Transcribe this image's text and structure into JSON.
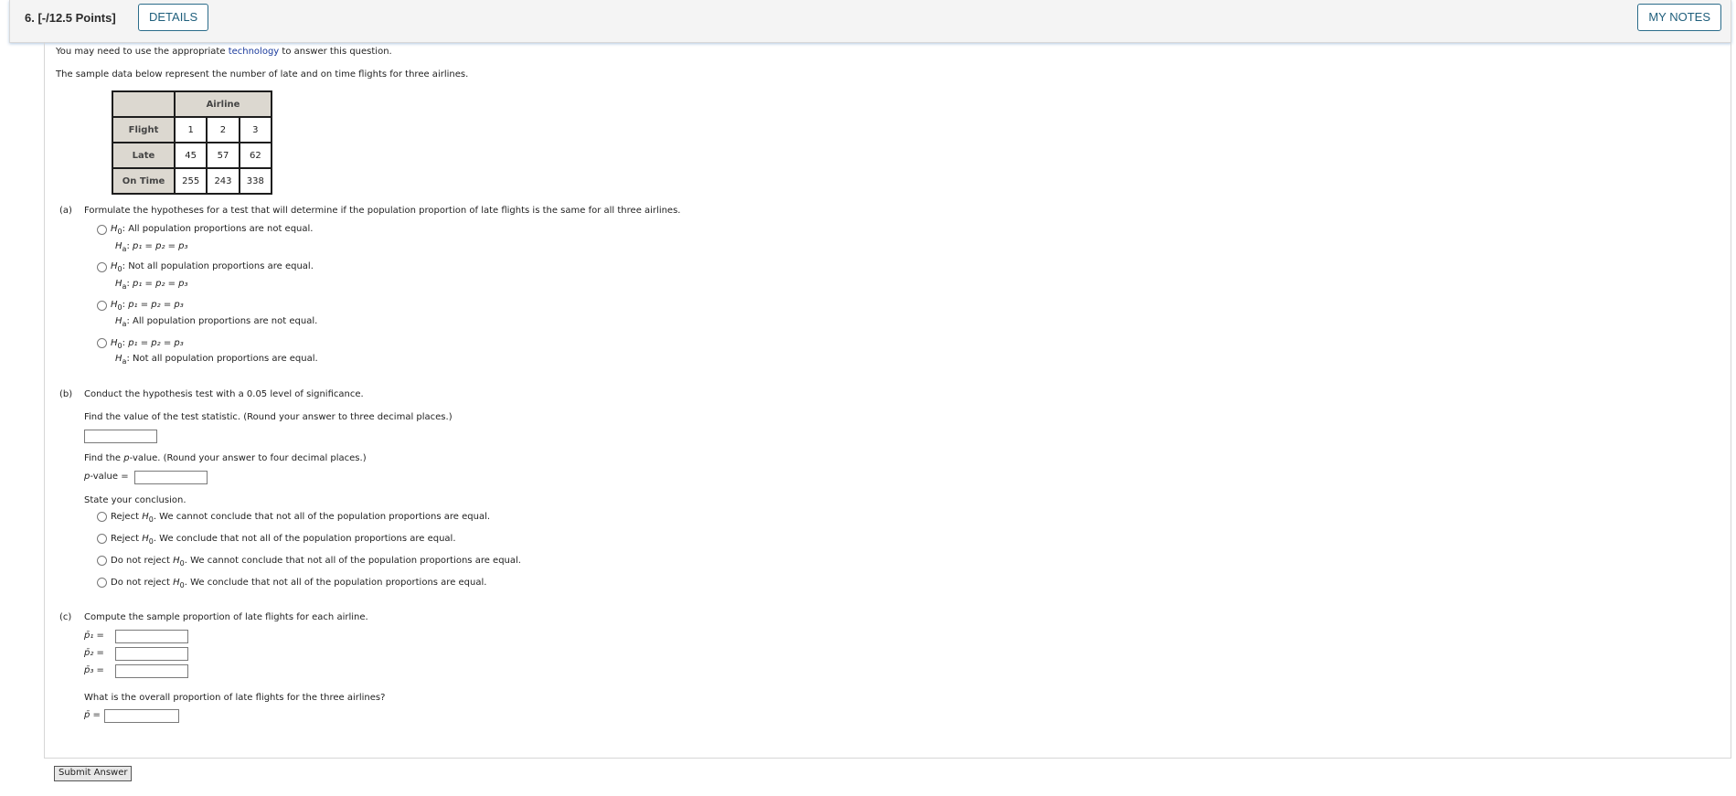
{
  "header": {
    "question_number": "6.  [-/12.5 Points]",
    "details_label": "DETAILS",
    "notes_label": "MY NOTES"
  },
  "intro": {
    "tech_prefix": "You may need to use the appropriate ",
    "tech_link": "technology",
    "tech_suffix": " to answer this question.",
    "data_sentence": "The sample data below represent the number of late and on time flights for three airlines."
  },
  "table": {
    "group_header": "Airline",
    "row_header_label": "Flight",
    "columns": [
      "1",
      "2",
      "3"
    ],
    "rows": [
      {
        "label": "Late",
        "values": [
          "45",
          "57",
          "62"
        ]
      },
      {
        "label": "On Time",
        "values": [
          "255",
          "243",
          "338"
        ]
      }
    ]
  },
  "part_a": {
    "label": "(a)",
    "prompt": "Formulate the hypotheses for a test that will determine if the population proportion of late flights is the same for all three airlines.",
    "options": [
      {
        "h0": "All population proportions are not equal.",
        "ha": "p₁ = p₂ = p₃"
      },
      {
        "h0": "Not all population proportions are equal.",
        "ha": "p₁ = p₂ = p₃"
      },
      {
        "h0": "p₁ = p₂ = p₃",
        "ha": "All population proportions are not equal."
      },
      {
        "h0": "p₁ = p₂ = p₃",
        "ha": "Not all population proportions are equal."
      }
    ]
  },
  "part_b": {
    "label": "(b)",
    "prompt": "Conduct the hypothesis test with a 0.05 level of significance.",
    "stat_prompt": "Find the value of the test statistic. (Round your answer to three decimal places.)",
    "stat_value": "",
    "pvalue_prompt_pre": "Find the ",
    "pvalue_prompt_p": "p",
    "pvalue_prompt_post": "-value. (Round your answer to four decimal places.)",
    "pvalue_label_p": "p",
    "pvalue_label_rest": "-value = ",
    "pvalue_value": "",
    "conclusion_prompt": "State your conclusion.",
    "conclusions": [
      {
        "pre": "Reject ",
        "post": ". We cannot conclude that not all of the population proportions are equal."
      },
      {
        "pre": "Reject ",
        "post": ". We conclude that not all of the population proportions are equal."
      },
      {
        "pre": "Do not reject ",
        "post": ". We cannot conclude that not all of the population proportions are equal."
      },
      {
        "pre": "Do not reject ",
        "post": ". We conclude that not all of the population proportions are equal."
      }
    ]
  },
  "part_c": {
    "label": "(c)",
    "prompt": "Compute the sample proportion of late flights for each airline.",
    "proportions": [
      {
        "label": "p̄₁ =",
        "value": ""
      },
      {
        "label": "p̄₂ =",
        "value": ""
      },
      {
        "label": "p̄₃ =",
        "value": ""
      }
    ],
    "overall_prompt": "What is the overall proportion of late flights for the three airlines?",
    "overall_label": "p̄ =",
    "overall_value": ""
  },
  "submit_label": "Submit Answer"
}
